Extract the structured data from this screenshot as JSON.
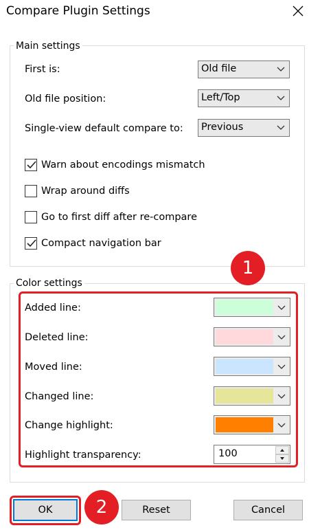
{
  "window": {
    "title": "Compare Plugin Settings"
  },
  "main_settings": {
    "legend": "Main settings",
    "first_is": {
      "label": "First is:",
      "value": "Old file"
    },
    "old_file_position": {
      "label": "Old file position:",
      "value": "Left/Top"
    },
    "single_view": {
      "label": "Single-view default compare to:",
      "value": "Previous"
    },
    "checkboxes": [
      {
        "label": "Warn about encodings mismatch",
        "checked": true
      },
      {
        "label": "Wrap around diffs",
        "checked": false
      },
      {
        "label": "Go to first diff after re-compare",
        "checked": false
      },
      {
        "label": "Compact navigation bar",
        "checked": true
      }
    ]
  },
  "color_settings": {
    "legend": "Color settings",
    "rows": [
      {
        "label": "Added line:",
        "color": "#ccffd9"
      },
      {
        "label": "Deleted line:",
        "color": "#ffd9dc"
      },
      {
        "label": "Moved line:",
        "color": "#cce5ff"
      },
      {
        "label": "Changed line:",
        "color": "#e6e69a"
      },
      {
        "label": "Change highlight:",
        "color": "#ff8000"
      }
    ],
    "transparency": {
      "label": "Highlight transparency:",
      "value": "100"
    }
  },
  "buttons": {
    "ok": "OK",
    "reset": "Reset",
    "cancel": "Cancel"
  },
  "annotations": {
    "badge1": "1",
    "badge2": "2",
    "accent": "#e31e24"
  }
}
